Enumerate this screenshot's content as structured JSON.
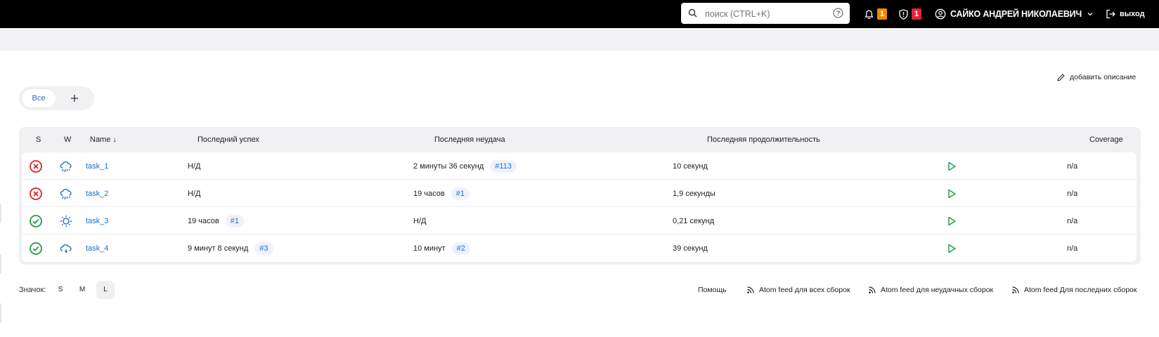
{
  "topbar": {
    "search_placeholder": "поиск (CTRL+K)",
    "notifications_count": "1",
    "notifications_color": "#f08c00",
    "security_count": "1",
    "security_color": "#e0243a",
    "user_name": "САЙКО АНДРЕЙ НИКОЛАЕВИЧ",
    "logout_label": "выход"
  },
  "page": {
    "add_description_label": "добавить описание",
    "tabs": [
      {
        "label": "Все"
      }
    ]
  },
  "table": {
    "headers": {
      "status": "S",
      "weather": "W",
      "name": "Name ↓",
      "last_success": "Последний успех",
      "last_failure": "Последняя неудача",
      "last_duration": "Последняя продолжительность",
      "coverage": "Coverage"
    },
    "rows": [
      {
        "status": "failed",
        "weather": "storm",
        "name": "task_1",
        "last_success": "Н/Д",
        "last_success_build": "",
        "last_failure": "2 минуты 36 секунд",
        "last_failure_build": "#113",
        "last_duration": "10 секунд",
        "coverage": "n/a"
      },
      {
        "status": "failed",
        "weather": "storm",
        "name": "task_2",
        "last_success": "Н/Д",
        "last_success_build": "",
        "last_failure": "19 часов",
        "last_failure_build": "#1",
        "last_duration": "1,9 секунды",
        "coverage": "n/a"
      },
      {
        "status": "success",
        "weather": "sunny",
        "name": "task_3",
        "last_success": "19 часов",
        "last_success_build": "#1",
        "last_failure": "Н/Д",
        "last_failure_build": "",
        "last_duration": "0,21 секунд",
        "coverage": "n/a"
      },
      {
        "status": "success",
        "weather": "cloudy",
        "name": "task_4",
        "last_success": "9 минут 8 секунд",
        "last_success_build": "#3",
        "last_failure": "10 минут",
        "last_failure_build": "#2",
        "last_duration": "39 секунд",
        "coverage": "n/a"
      }
    ]
  },
  "footer": {
    "icon_size_label": "Значок:",
    "sizes": [
      "S",
      "M",
      "L"
    ],
    "selected_size": "L",
    "links": {
      "help": "Помощь",
      "atom_all": "Atom feed для всех сборок",
      "atom_failed": "Atom feed для неудачных сборок",
      "atom_latest": "Atom feed Для последних сборок"
    }
  },
  "colors": {
    "link": "#1f6fd1",
    "failed": "#d9232e",
    "success": "#1f9c4b",
    "run": "#1f9c4b"
  }
}
